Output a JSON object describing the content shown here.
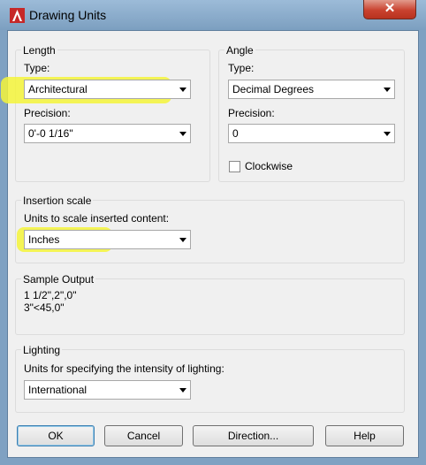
{
  "window": {
    "title": "Drawing Units",
    "close_glyph": "✕",
    "accent": "#c9422f"
  },
  "length": {
    "group_label": "Length",
    "type_label": "Type:",
    "type_value": "Architectural",
    "precision_label": "Precision:",
    "precision_value": "0'-0 1/16\""
  },
  "angle": {
    "group_label": "Angle",
    "type_label": "Type:",
    "type_value": "Decimal Degrees",
    "precision_label": "Precision:",
    "precision_value": "0",
    "clockwise_label": "Clockwise",
    "clockwise_checked": false
  },
  "insertion": {
    "group_label": "Insertion scale",
    "units_label": "Units to scale inserted content:",
    "units_value": "Inches"
  },
  "sample": {
    "group_label": "Sample Output",
    "line1": "1 1/2\",2\",0\"",
    "line2": "3\"<45,0\""
  },
  "lighting": {
    "group_label": "Lighting",
    "units_label": "Units for specifying the intensity of lighting:",
    "units_value": "International"
  },
  "buttons": {
    "ok": "OK",
    "cancel": "Cancel",
    "direction": "Direction...",
    "help": "Help"
  },
  "highlight_color": "#f4f43a"
}
